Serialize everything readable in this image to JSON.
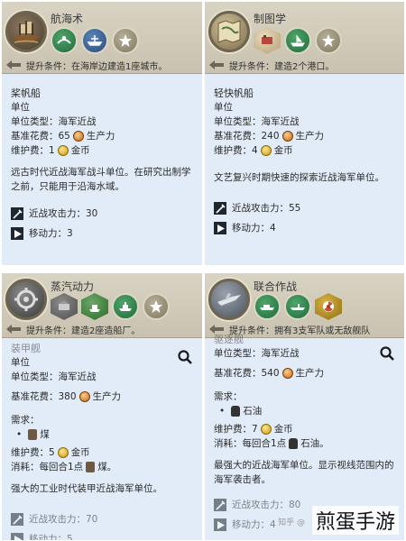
{
  "panels": {
    "tl": {
      "tech_title": "航海术",
      "boost": "提升条件：在海岸边建造1座城市。",
      "unit_name": "桨帆船",
      "unit_label": "单位",
      "unit_type": "单位类型：海军近战",
      "cost_label": "基准花费：65",
      "cost_unit": "生产力",
      "upkeep_label": "维护费：1",
      "upkeep_unit": "金币",
      "desc": "远古时代近战海军战斗单位。在研究出制学之前，只能用于沿海水域。",
      "melee": "近战攻击力：30",
      "move": "移动力：3"
    },
    "tr": {
      "tech_title": "制图学",
      "boost": "提升条件：建造2个港口。",
      "unit_name": "轻快帆船",
      "unit_label": "单位",
      "unit_type": "单位类型：海军近战",
      "cost_label": "基准花费：240",
      "cost_unit": "生产力",
      "upkeep_label": "维护费：4",
      "upkeep_unit": "金币",
      "desc": "文艺复兴时期快速的探索近战海军单位。",
      "melee": "近战攻击力：55",
      "move": "移动力：4"
    },
    "bl": {
      "tech_title": "蒸汽动力",
      "boost": "提升条件：建造2座造船厂。",
      "unit_name": "装甲舰",
      "unit_label": "单位",
      "unit_type": "单位类型：海军近战",
      "cost_label": "基准花费：380",
      "cost_unit": "生产力",
      "needs_label": "需求：",
      "need_item": "煤",
      "upkeep_label": "维护费：5",
      "upkeep_unit": "金币",
      "consume": "消耗：每回合1点",
      "consume_item": "煤。",
      "desc": "强大的工业时代装甲近战海军单位。",
      "melee": "近战攻击力：70",
      "move": "移动力：5"
    },
    "br": {
      "tech_title": "联合作战",
      "boost": "提升条件：拥有3支军队或无敌舰队",
      "unit_name": "驱逐舰",
      "unit_label": "单位",
      "unit_type": "单位类型：海军近战",
      "cost_label": "基准花费：540",
      "cost_unit": "生产力",
      "needs_label": "需求：",
      "need_item": "石油",
      "upkeep_label": "维护费：7",
      "upkeep_unit": "金币",
      "consume": "消耗：每回合1点",
      "consume_item": "石油。",
      "desc": "最强大的近战海军单位。显示视线范围内的海军袭击者。",
      "melee": "近战攻击力：80",
      "move": "移动力：4"
    }
  },
  "watermark": "煎蛋手游",
  "watermark_small": "知乎 @"
}
